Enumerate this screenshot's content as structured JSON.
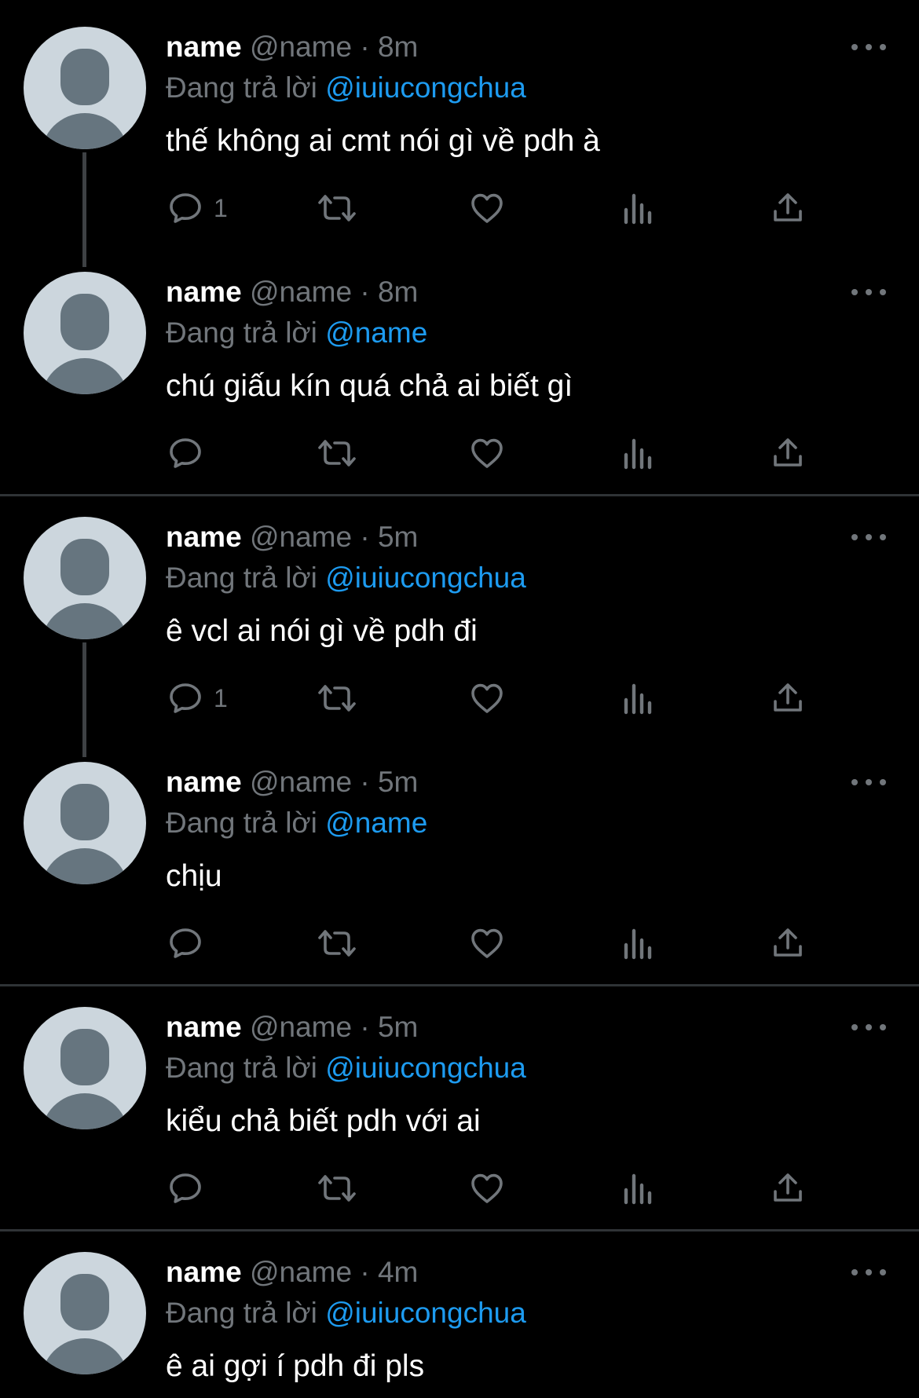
{
  "colors": {
    "background": "#000000",
    "text_primary": "#ffffff",
    "text_secondary": "#71767b",
    "accent": "#1d9bf0",
    "divider": "#2f3336",
    "avatar_bg": "#ccd6dd",
    "avatar_fg": "#66757f"
  },
  "icons": {
    "reply": "reply-icon",
    "retweet": "retweet-icon",
    "like": "heart-icon",
    "views": "analytics-icon",
    "share": "share-icon",
    "more": "more-icon"
  },
  "tweets": [
    {
      "name": "name",
      "handle": "@name",
      "separator": "·",
      "time": "8m",
      "reply_prefix": "Đang trả lời",
      "reply_to": "@iuiucongchua",
      "text": "thế không ai cmt nói gì về pdh à",
      "reply_count": "1"
    },
    {
      "name": "name",
      "handle": "@name",
      "separator": "·",
      "time": "8m",
      "reply_prefix": "Đang trả lời",
      "reply_to": "@name",
      "text": "chú giấu kín quá chả ai biết gì",
      "reply_count": ""
    },
    {
      "name": "name",
      "handle": "@name",
      "separator": "·",
      "time": "5m",
      "reply_prefix": "Đang trả lời",
      "reply_to": "@iuiucongchua",
      "text": "ê vcl ai nói gì về pdh đi",
      "reply_count": "1"
    },
    {
      "name": "name",
      "handle": "@name",
      "separator": "·",
      "time": "5m",
      "reply_prefix": "Đang trả lời",
      "reply_to": "@name",
      "text": "chịu",
      "reply_count": ""
    },
    {
      "name": "name",
      "handle": "@name",
      "separator": "·",
      "time": "5m",
      "reply_prefix": "Đang trả lời",
      "reply_to": "@iuiucongchua",
      "text": "kiểu chả biết pdh với ai",
      "reply_count": ""
    },
    {
      "name": "name",
      "handle": "@name",
      "separator": "·",
      "time": "4m",
      "reply_prefix": "Đang trả lời",
      "reply_to": "@iuiucongchua",
      "text": "ê ai gợi í pdh đi pls",
      "reply_count": ""
    }
  ]
}
